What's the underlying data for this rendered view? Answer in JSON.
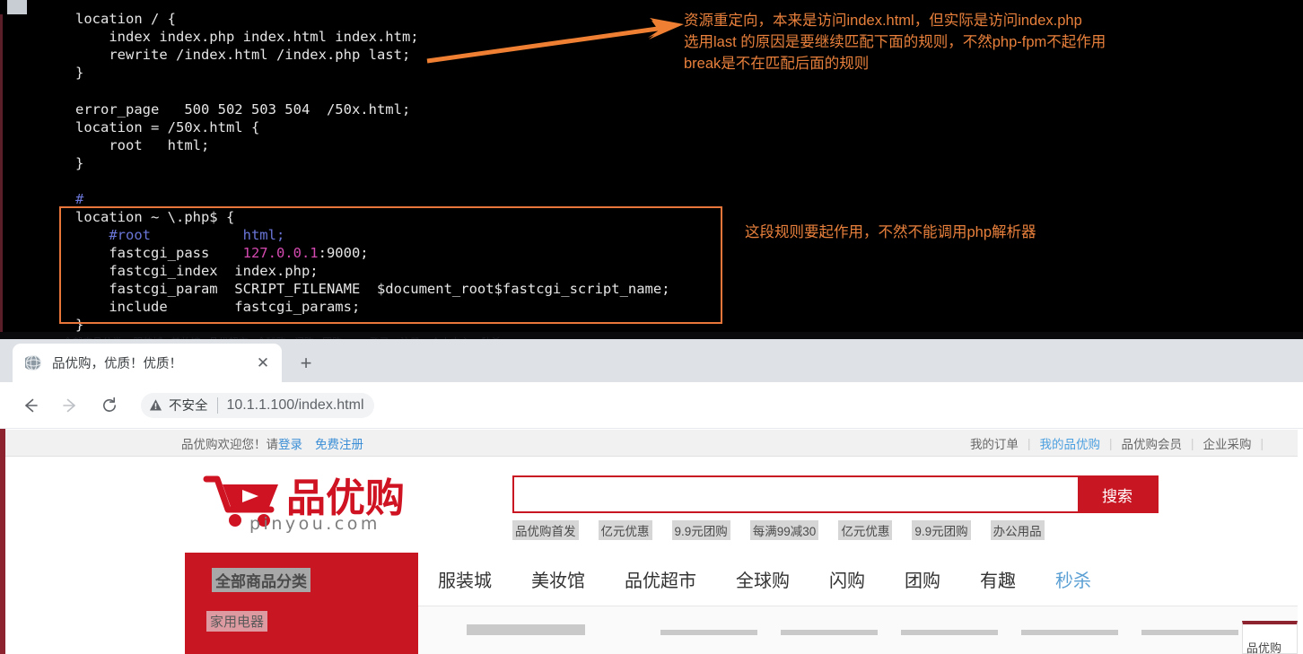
{
  "terminal": {
    "code_block_1": "location / {\n    index index.php index.html index.htm;\n    rewrite /index.html /index.php last;\n}",
    "code_block_2": "error_page   500 502 503 504  /50x.html;\nlocation = /50x.html {\n    root   html;\n}",
    "php_block": {
      "comment_hash": "#",
      "line_open": "location ~ \\.php$ {",
      "line_root_comment": "    #root           html;",
      "line_fastcgi_pass_key": "    fastcgi_pass    ",
      "line_fastcgi_pass_ip": "127.0.0.1",
      "line_fastcgi_pass_rest": ":9000;",
      "line_fastcgi_index": "    fastcgi_index  index.php;",
      "line_fastcgi_param": "    fastcgi_param  SCRIPT_FILENAME  $document_root$fastcgi_script_name;",
      "line_include": "    include        fastcgi_params;",
      "line_close": "}"
    },
    "annotation_1": "资源重定向，本来是访问index.html，但实际是访问index.php\n选用last 的原因是要继续匹配下面的规则，不然php-fpm不起作用\nbreak是不在匹配后面的规则",
    "annotation_2": "这段规则要起作用，不然不能调用php解析器",
    "annotation_color": "#e8803c",
    "box_color": "#e8763a",
    "ghost_row": "全部商品分类    服装城   美妆馆   品优超市   全球购   闪购   团购          登录    注册    个人中心    秒杀"
  },
  "browser": {
    "tab": {
      "favicon": "globe-icon",
      "title": "品优购，优质！优质！",
      "close_label": "✕"
    },
    "new_tab_label": "+",
    "toolbar": {
      "back_icon": "arrow-left-icon",
      "forward_icon": "arrow-right-icon",
      "reload_icon": "reload-icon",
      "security_icon": "warning-triangle-icon",
      "security_text": "不安全",
      "url": "10.1.1.100/index.html"
    }
  },
  "page": {
    "shortcut": {
      "welcome": "品优购欢迎您！请",
      "login": "登录",
      "register": "免费注册",
      "right_items": [
        {
          "label": "我的订单",
          "highlight": false
        },
        {
          "label": "我的品优购",
          "highlight": true
        },
        {
          "label": "品优购会员",
          "highlight": false
        },
        {
          "label": "企业采购",
          "highlight": false
        }
      ],
      "separator": "|"
    },
    "logo": {
      "icon": "shopping-cart-icon",
      "brand": "品优购",
      "domain": "pinyou.com",
      "color": "#c81623"
    },
    "search": {
      "value": "",
      "placeholder": "",
      "button_label": "搜索",
      "accent": "#c81623"
    },
    "hotwords": [
      "品优购首发",
      "亿元优惠",
      "9.9元团购",
      "每满99减30",
      "亿元优惠",
      "9.9元团购",
      "办公用品"
    ],
    "category": {
      "title": "全部商品分类",
      "first_item": "家用电器"
    },
    "nav_items": [
      {
        "label": "服装城",
        "highlight": false
      },
      {
        "label": "美妆馆",
        "highlight": false
      },
      {
        "label": "品优超市",
        "highlight": false
      },
      {
        "label": "全球购",
        "highlight": false
      },
      {
        "label": "闪购",
        "highlight": false
      },
      {
        "label": "团购",
        "highlight": false
      },
      {
        "label": "有趣",
        "highlight": false
      },
      {
        "label": "秒杀",
        "highlight": true
      }
    ],
    "float_panel_text": "品优购"
  }
}
